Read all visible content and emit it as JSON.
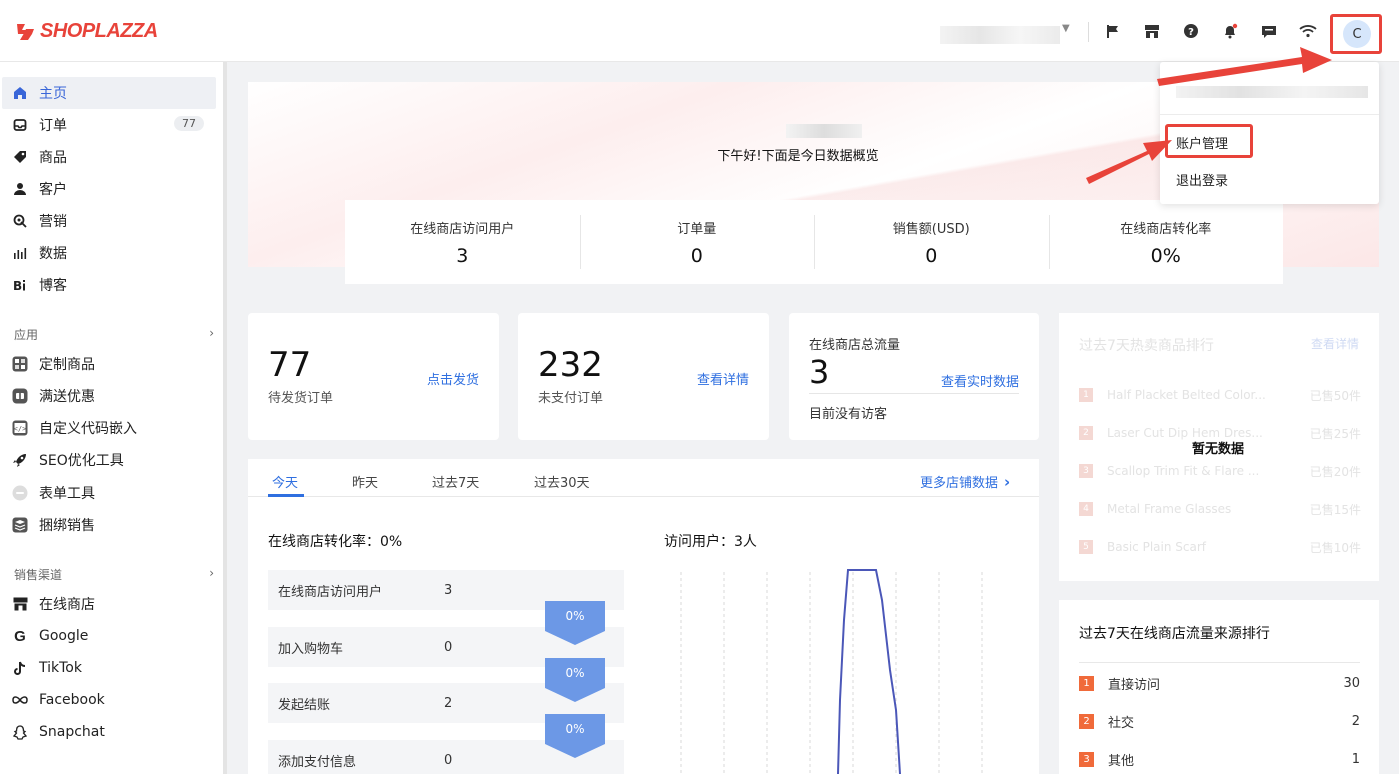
{
  "brand": {
    "name": "SHOPLAZZA",
    "color": "#e8433a"
  },
  "header": {
    "icons": [
      "flag-icon",
      "store-icon",
      "help-icon",
      "bell-icon",
      "message-icon",
      "wifi-icon"
    ],
    "avatar_letter": "C"
  },
  "user_menu": {
    "account_label": "账户管理",
    "logout_label": "退出登录"
  },
  "sidebar": {
    "items": [
      {
        "label": "主页",
        "icon": "home-icon",
        "active": true
      },
      {
        "label": "订单",
        "icon": "inbox-icon",
        "badge": "77"
      },
      {
        "label": "商品",
        "icon": "tag-icon"
      },
      {
        "label": "客户",
        "icon": "user-icon"
      },
      {
        "label": "营销",
        "icon": "marketing-icon"
      },
      {
        "label": "数据",
        "icon": "bar-chart-icon"
      },
      {
        "label": "博客",
        "icon": "blog-icon"
      }
    ],
    "apps_section": "应用",
    "apps": [
      {
        "label": "定制商品",
        "icon": "custom-product-icon"
      },
      {
        "label": "满送优惠",
        "icon": "gift-icon"
      },
      {
        "label": "自定义代码嵌入",
        "icon": "code-icon"
      },
      {
        "label": "SEO优化工具",
        "icon": "rocket-icon"
      },
      {
        "label": "表单工具",
        "icon": "form-icon"
      },
      {
        "label": "捆绑销售",
        "icon": "bundle-icon"
      }
    ],
    "channels_section": "销售渠道",
    "channels": [
      {
        "label": "在线商店",
        "icon": "store-icon"
      },
      {
        "label": "Google",
        "icon": "google-icon"
      },
      {
        "label": "TikTok",
        "icon": "tiktok-icon"
      },
      {
        "label": "Facebook",
        "icon": "facebook-icon"
      },
      {
        "label": "Snapchat",
        "icon": "snapchat-icon"
      }
    ]
  },
  "hero": {
    "greeting": "下午好!下面是今日数据概览"
  },
  "stats": [
    {
      "label": "在线商店访问用户",
      "value": "3"
    },
    {
      "label": "订单量",
      "value": "0"
    },
    {
      "label": "销售额(USD)",
      "value": "0"
    },
    {
      "label": "在线商店转化率",
      "value": "0%"
    }
  ],
  "cards": {
    "pending": {
      "value": "77",
      "label": "待发货订单",
      "link": "点击发货"
    },
    "unpaid": {
      "value": "232",
      "label": "未支付订单",
      "link": "查看详情"
    },
    "traffic": {
      "title": "在线商店总流量",
      "value": "3",
      "link": "查看实时数据",
      "note": "目前没有访客"
    }
  },
  "period_tabs": [
    "今天",
    "昨天",
    "过去7天",
    "过去30天"
  ],
  "more_link": "更多店铺数据",
  "conversion": {
    "title": "在线商店转化率：0%",
    "funnel": [
      {
        "label": "在线商店访问用户",
        "value": "3"
      },
      {
        "label": "加入购物车",
        "value": "0"
      },
      {
        "label": "发起结账",
        "value": "2"
      },
      {
        "label": "添加支付信息",
        "value": "0"
      }
    ],
    "rates": [
      "0%",
      "0%",
      "0%"
    ]
  },
  "visitors": {
    "title": "访问用户：3人"
  },
  "hot_products": {
    "title": "过去7天热卖商品排行",
    "link": "查看详情",
    "empty": "暂无数据",
    "items": [
      {
        "rank": "1",
        "name": "Half Placket Belted Color...",
        "sold": "已售50件"
      },
      {
        "rank": "2",
        "name": "Laser Cut Dip Hem Dres...",
        "sold": "已售25件"
      },
      {
        "rank": "3",
        "name": "Scallop Trim Fit & Flare ...",
        "sold": "已售20件"
      },
      {
        "rank": "4",
        "name": "Metal Frame Glasses",
        "sold": "已售15件"
      },
      {
        "rank": "5",
        "name": "Basic Plain Scarf",
        "sold": "已售10件"
      }
    ]
  },
  "traffic_sources": {
    "title": "过去7天在线商店流量来源排行",
    "items": [
      {
        "rank": "1",
        "name": "直接访问",
        "count": "30"
      },
      {
        "rank": "2",
        "name": "社交",
        "count": "2"
      },
      {
        "rank": "3",
        "name": "其他",
        "count": "1"
      }
    ]
  },
  "colors": {
    "accent": "#2f6fe0",
    "highlight": "#e8433a",
    "funnel": "#6c98e6",
    "line": "#4b57b8"
  }
}
